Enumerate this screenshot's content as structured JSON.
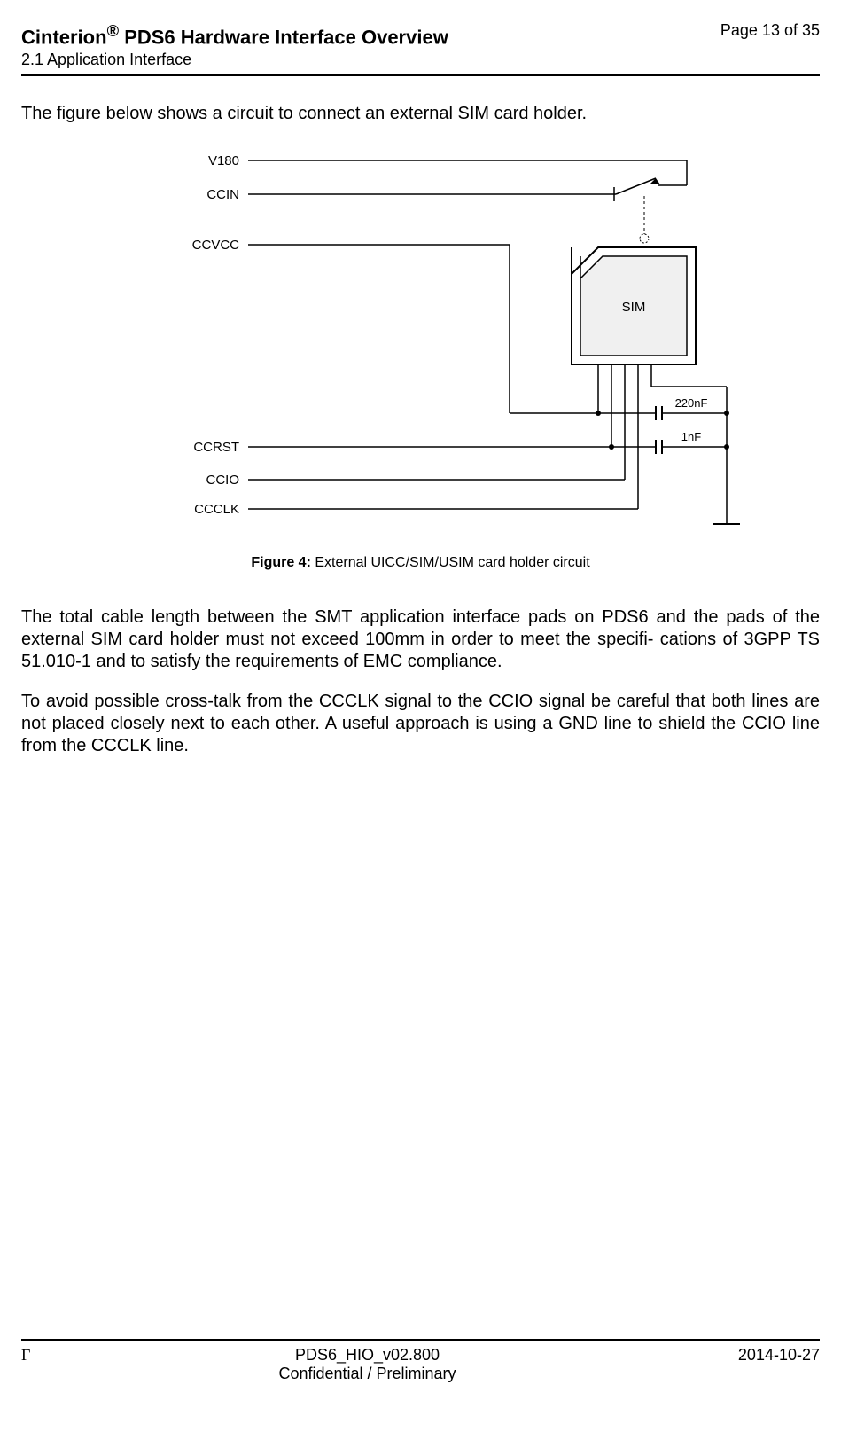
{
  "header": {
    "title_prefix": "Cinterion",
    "title_suffix": " PDS6 Hardware Interface Overview",
    "reg": "®",
    "section": "2.1 Application Interface",
    "page_label": "Page 13 of 35"
  },
  "intro_text": "The figure below shows a circuit to connect an external SIM card holder.",
  "diagram": {
    "labels": {
      "v180": "V180",
      "ccin": "CCIN",
      "ccvcc": "CCVCC",
      "ccrst": "CCRST",
      "ccio": "CCIO",
      "ccclk": "CCCLK",
      "sim": "SIM",
      "cap1": "220nF",
      "cap2": "1nF"
    }
  },
  "figure_caption": {
    "label": "Figure 4:",
    "text": "  External UICC/SIM/USIM card holder circuit"
  },
  "para1": "The total cable length between the SMT application interface pads on PDS6 and  the pads of the external SIM card holder must not exceed 100mm in order to meet the specifi- cations of 3GPP TS 51.010-1 and to satisfy the requirements of EMC compliance.",
  "para2": "To avoid possible cross-talk from the CCCLK signal to the CCIO signal be careful that both lines are not placed closely next to each other. A useful approach is using a GND line to shield the CCIO line from the CCCLK line.",
  "footer": {
    "left": "Γ",
    "center_line1": "PDS6_HIO_v02.800",
    "center_line2": "Confidential / Preliminary",
    "right": "2014-10-27"
  }
}
